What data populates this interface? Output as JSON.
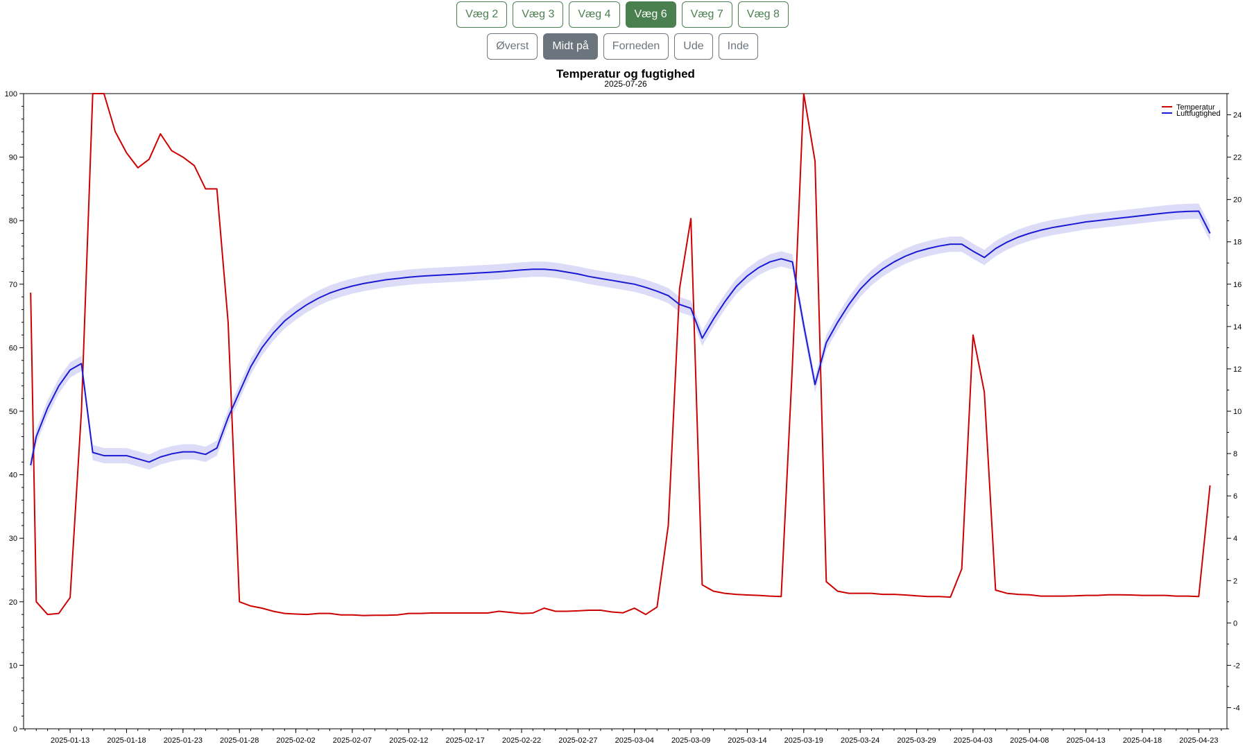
{
  "walls": [
    {
      "label": "Væg 2",
      "active": false
    },
    {
      "label": "Væg 3",
      "active": false
    },
    {
      "label": "Væg 4",
      "active": false
    },
    {
      "label": "Væg 6",
      "active": true
    },
    {
      "label": "Væg 7",
      "active": false
    },
    {
      "label": "Væg 8",
      "active": false
    }
  ],
  "positions": [
    {
      "label": "Øverst",
      "active": false
    },
    {
      "label": "Midt på",
      "active": true
    },
    {
      "label": "Forneden",
      "active": false
    },
    {
      "label": "Ude",
      "active": false
    },
    {
      "label": "Inde",
      "active": false
    }
  ],
  "colors": {
    "wall_green": "#4a7f4f",
    "pos_gray": "#6c757d",
    "temperature": "#cc0000",
    "humidity": "#1a1ad4",
    "humidity_band": "#dcdcf8"
  },
  "chart_data": {
    "type": "line",
    "title": "Temperatur og fugtighed",
    "subtitle": "2025-07-26",
    "legend_position": "top-right",
    "grid": false,
    "x_ticks": [
      "2025-01-13",
      "2025-01-18",
      "2025-01-23",
      "2025-01-28",
      "2025-02-02",
      "2025-02-07",
      "2025-02-12",
      "2025-02-17",
      "2025-02-22",
      "2025-02-27",
      "2025-03-04",
      "2025-03-09",
      "2025-03-14",
      "2025-03-19",
      "2025-03-24",
      "2025-03-29",
      "2025-04-03",
      "2025-04-08",
      "2025-04-13",
      "2025-04-18",
      "2025-04-23"
    ],
    "xlim": [
      "2025-01-08T21:00",
      "2025-04-25T12:00"
    ],
    "y_left": {
      "range": [
        0,
        100
      ],
      "ticks": [
        0,
        10,
        20,
        30,
        40,
        50,
        60,
        70,
        80,
        90,
        100
      ]
    },
    "y_right": {
      "range": [
        -5,
        25
      ],
      "ticks": [
        -4,
        -2,
        0,
        2,
        4,
        6,
        8,
        10,
        12,
        14,
        16,
        18,
        20,
        22,
        24
      ]
    },
    "series": [
      {
        "name": "Temperatur",
        "axis": "right",
        "points": [
          [
            "2025-01-09T12:00",
            15.6
          ],
          [
            "2025-01-10",
            1
          ],
          [
            "2025-01-11",
            0.4
          ],
          [
            "2025-01-12",
            0.45
          ],
          [
            "2025-01-13",
            1.2
          ],
          [
            "2025-01-14",
            10
          ],
          [
            "2025-01-15",
            26
          ],
          [
            "2025-01-16",
            26
          ],
          [
            "2025-01-17",
            23.2
          ],
          [
            "2025-01-18",
            22.2
          ],
          [
            "2025-01-19",
            21.5
          ],
          [
            "2025-01-20",
            21.9
          ],
          [
            "2025-01-21",
            23.1
          ],
          [
            "2025-01-22",
            22.3
          ],
          [
            "2025-01-23",
            22
          ],
          [
            "2025-01-24",
            21.6
          ],
          [
            "2025-01-25",
            20.5
          ],
          [
            "2025-01-26",
            20.5
          ],
          [
            "2025-01-27",
            14.2
          ],
          [
            "2025-01-28",
            1
          ],
          [
            "2025-01-29",
            0.8
          ],
          [
            "2025-01-30",
            0.7
          ],
          [
            "2025-01-31",
            0.55
          ],
          [
            "2025-02-01",
            0.45
          ],
          [
            "2025-02-02",
            0.42
          ],
          [
            "2025-02-03",
            0.4
          ],
          [
            "2025-02-04",
            0.45
          ],
          [
            "2025-02-05",
            0.45
          ],
          [
            "2025-02-06",
            0.38
          ],
          [
            "2025-02-07",
            0.38
          ],
          [
            "2025-02-08",
            0.35
          ],
          [
            "2025-02-09",
            0.36
          ],
          [
            "2025-02-10",
            0.36
          ],
          [
            "2025-02-11",
            0.38
          ],
          [
            "2025-02-12",
            0.45
          ],
          [
            "2025-02-13",
            0.45
          ],
          [
            "2025-02-14",
            0.47
          ],
          [
            "2025-02-15",
            0.47
          ],
          [
            "2025-02-16",
            0.47
          ],
          [
            "2025-02-17",
            0.47
          ],
          [
            "2025-02-18",
            0.47
          ],
          [
            "2025-02-19",
            0.47
          ],
          [
            "2025-02-20",
            0.55
          ],
          [
            "2025-02-21",
            0.5
          ],
          [
            "2025-02-22",
            0.45
          ],
          [
            "2025-02-23",
            0.47
          ],
          [
            "2025-02-24",
            0.7
          ],
          [
            "2025-02-25",
            0.55
          ],
          [
            "2025-02-26",
            0.55
          ],
          [
            "2025-02-27",
            0.57
          ],
          [
            "2025-02-28",
            0.6
          ],
          [
            "2025-03-01",
            0.6
          ],
          [
            "2025-03-02",
            0.52
          ],
          [
            "2025-03-03",
            0.48
          ],
          [
            "2025-03-04",
            0.7
          ],
          [
            "2025-03-05",
            0.4
          ],
          [
            "2025-03-06",
            0.75
          ],
          [
            "2025-03-07",
            4.6
          ],
          [
            "2025-03-08",
            15.8
          ],
          [
            "2025-03-09",
            19.1
          ],
          [
            "2025-03-10",
            1.8
          ],
          [
            "2025-03-11",
            1.5
          ],
          [
            "2025-03-12",
            1.4
          ],
          [
            "2025-03-13",
            1.35
          ],
          [
            "2025-03-14",
            1.32
          ],
          [
            "2025-03-15",
            1.3
          ],
          [
            "2025-03-16",
            1.27
          ],
          [
            "2025-03-17",
            1.25
          ],
          [
            "2025-03-18",
            12.2
          ],
          [
            "2025-03-19",
            26
          ],
          [
            "2025-03-20",
            21.8
          ],
          [
            "2025-03-21",
            1.95
          ],
          [
            "2025-03-22",
            1.5
          ],
          [
            "2025-03-23",
            1.4
          ],
          [
            "2025-03-24",
            1.4
          ],
          [
            "2025-03-25",
            1.4
          ],
          [
            "2025-03-26",
            1.35
          ],
          [
            "2025-03-27",
            1.35
          ],
          [
            "2025-03-28",
            1.32
          ],
          [
            "2025-03-29",
            1.28
          ],
          [
            "2025-03-30",
            1.25
          ],
          [
            "2025-03-31",
            1.25
          ],
          [
            "2025-04-01",
            1.22
          ],
          [
            "2025-04-02",
            2.55
          ],
          [
            "2025-04-03",
            13.6
          ],
          [
            "2025-04-04",
            10.9
          ],
          [
            "2025-04-05",
            1.55
          ],
          [
            "2025-04-06",
            1.4
          ],
          [
            "2025-04-07",
            1.35
          ],
          [
            "2025-04-08",
            1.33
          ],
          [
            "2025-04-09",
            1.27
          ],
          [
            "2025-04-10",
            1.27
          ],
          [
            "2025-04-11",
            1.27
          ],
          [
            "2025-04-12",
            1.28
          ],
          [
            "2025-04-13",
            1.3
          ],
          [
            "2025-04-14",
            1.3
          ],
          [
            "2025-04-15",
            1.33
          ],
          [
            "2025-04-16",
            1.33
          ],
          [
            "2025-04-17",
            1.32
          ],
          [
            "2025-04-18",
            1.3
          ],
          [
            "2025-04-19",
            1.3
          ],
          [
            "2025-04-20",
            1.3
          ],
          [
            "2025-04-21",
            1.27
          ],
          [
            "2025-04-22",
            1.27
          ],
          [
            "2025-04-23",
            1.25
          ],
          [
            "2025-04-24",
            6.5
          ]
        ]
      },
      {
        "name": "Luftfugtighed",
        "axis": "left",
        "band": 1.2,
        "points": [
          [
            "2025-01-09T12:00",
            41.5
          ],
          [
            "2025-01-10",
            46
          ],
          [
            "2025-01-11",
            50.5
          ],
          [
            "2025-01-12",
            54
          ],
          [
            "2025-01-13",
            56.5
          ],
          [
            "2025-01-14",
            57.5
          ],
          [
            "2025-01-15",
            43.5
          ],
          [
            "2025-01-16",
            43
          ],
          [
            "2025-01-17",
            43
          ],
          [
            "2025-01-18",
            43
          ],
          [
            "2025-01-19",
            42.5
          ],
          [
            "2025-01-20",
            42
          ],
          [
            "2025-01-21",
            42.8
          ],
          [
            "2025-01-22",
            43.3
          ],
          [
            "2025-01-23",
            43.6
          ],
          [
            "2025-01-24",
            43.6
          ],
          [
            "2025-01-25",
            43.2
          ],
          [
            "2025-01-26",
            44.2
          ],
          [
            "2025-01-27",
            49
          ],
          [
            "2025-01-28",
            53
          ],
          [
            "2025-01-29",
            57
          ],
          [
            "2025-01-30",
            60
          ],
          [
            "2025-01-31",
            62.3
          ],
          [
            "2025-02-01",
            64.2
          ],
          [
            "2025-02-02",
            65.6
          ],
          [
            "2025-02-03",
            66.8
          ],
          [
            "2025-02-04",
            67.8
          ],
          [
            "2025-02-05",
            68.6
          ],
          [
            "2025-02-06",
            69.2
          ],
          [
            "2025-02-07",
            69.7
          ],
          [
            "2025-02-08",
            70.1
          ],
          [
            "2025-02-09",
            70.4
          ],
          [
            "2025-02-10",
            70.7
          ],
          [
            "2025-02-11",
            70.9
          ],
          [
            "2025-02-12",
            71.1
          ],
          [
            "2025-02-13",
            71.25
          ],
          [
            "2025-02-14",
            71.35
          ],
          [
            "2025-02-15",
            71.45
          ],
          [
            "2025-02-16",
            71.55
          ],
          [
            "2025-02-17",
            71.65
          ],
          [
            "2025-02-18",
            71.75
          ],
          [
            "2025-02-19",
            71.85
          ],
          [
            "2025-02-20",
            71.95
          ],
          [
            "2025-02-21",
            72.1
          ],
          [
            "2025-02-22",
            72.25
          ],
          [
            "2025-02-23",
            72.35
          ],
          [
            "2025-02-24",
            72.35
          ],
          [
            "2025-02-25",
            72.2
          ],
          [
            "2025-02-26",
            71.9
          ],
          [
            "2025-02-27",
            71.6
          ],
          [
            "2025-02-28",
            71.2
          ],
          [
            "2025-03-01",
            70.9
          ],
          [
            "2025-03-02",
            70.6
          ],
          [
            "2025-03-03",
            70.3
          ],
          [
            "2025-03-04",
            70
          ],
          [
            "2025-03-05",
            69.5
          ],
          [
            "2025-03-06",
            68.9
          ],
          [
            "2025-03-07",
            68.2
          ],
          [
            "2025-03-08",
            66.8
          ],
          [
            "2025-03-09",
            66.2
          ],
          [
            "2025-03-10",
            61.5
          ],
          [
            "2025-03-11",
            64.5
          ],
          [
            "2025-03-12",
            67.2
          ],
          [
            "2025-03-13",
            69.6
          ],
          [
            "2025-03-14",
            71.3
          ],
          [
            "2025-03-15",
            72.6
          ],
          [
            "2025-03-16",
            73.5
          ],
          [
            "2025-03-17",
            74
          ],
          [
            "2025-03-18",
            73.5
          ],
          [
            "2025-03-19",
            63.5
          ],
          [
            "2025-03-20",
            54.2
          ],
          [
            "2025-03-21",
            60.8
          ],
          [
            "2025-03-22",
            64
          ],
          [
            "2025-03-23",
            66.8
          ],
          [
            "2025-03-24",
            69.2
          ],
          [
            "2025-03-25",
            71
          ],
          [
            "2025-03-26",
            72.4
          ],
          [
            "2025-03-27",
            73.5
          ],
          [
            "2025-03-28",
            74.4
          ],
          [
            "2025-03-29",
            75.1
          ],
          [
            "2025-03-30",
            75.6
          ],
          [
            "2025-03-31",
            76
          ],
          [
            "2025-04-01",
            76.3
          ],
          [
            "2025-04-02",
            76.3
          ],
          [
            "2025-04-03",
            75.2
          ],
          [
            "2025-04-04",
            74.2
          ],
          [
            "2025-04-05",
            75.6
          ],
          [
            "2025-04-06",
            76.6
          ],
          [
            "2025-04-07",
            77.4
          ],
          [
            "2025-04-08",
            78
          ],
          [
            "2025-04-09",
            78.5
          ],
          [
            "2025-04-10",
            78.9
          ],
          [
            "2025-04-11",
            79.2
          ],
          [
            "2025-04-12",
            79.5
          ],
          [
            "2025-04-13",
            79.8
          ],
          [
            "2025-04-14",
            80
          ],
          [
            "2025-04-15",
            80.2
          ],
          [
            "2025-04-16",
            80.4
          ],
          [
            "2025-04-17",
            80.6
          ],
          [
            "2025-04-18",
            80.8
          ],
          [
            "2025-04-19",
            81
          ],
          [
            "2025-04-20",
            81.2
          ],
          [
            "2025-04-21",
            81.35
          ],
          [
            "2025-04-22",
            81.45
          ],
          [
            "2025-04-23",
            81.5
          ],
          [
            "2025-04-24",
            78
          ]
        ]
      }
    ]
  }
}
